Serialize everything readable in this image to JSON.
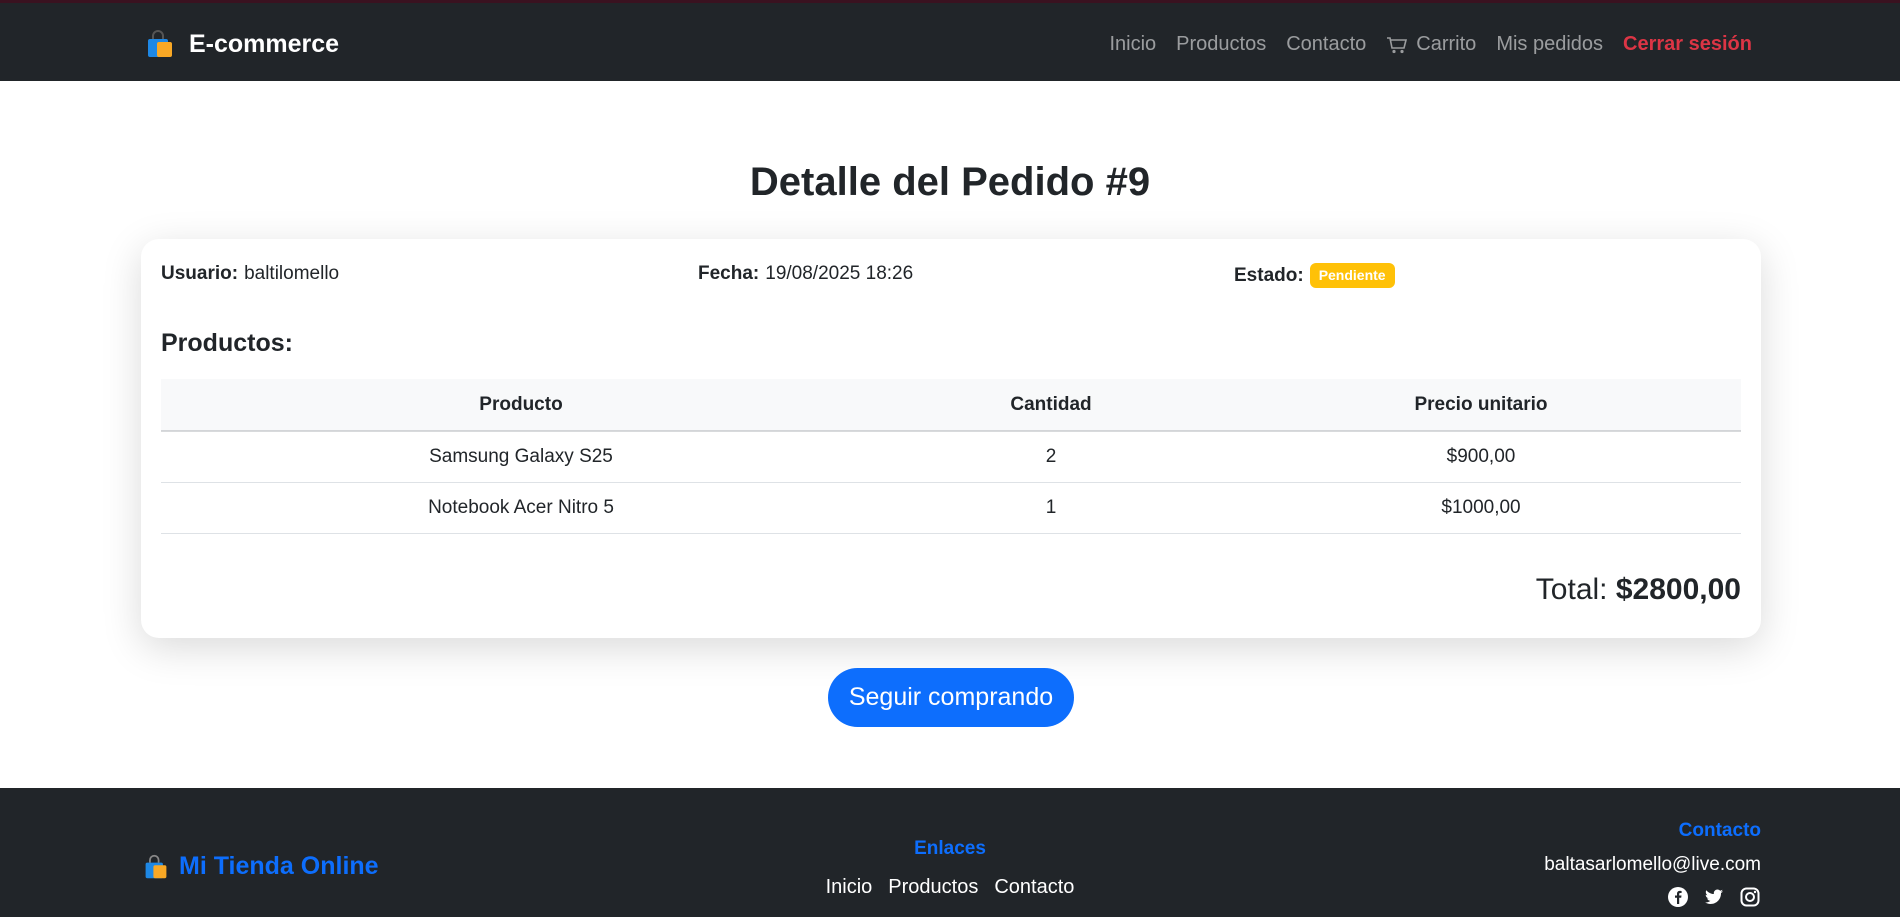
{
  "navbar": {
    "brand": "E-commerce",
    "links": [
      "Inicio",
      "Productos",
      "Contacto",
      "Carrito",
      "Mis pedidos"
    ],
    "logout": "Cerrar sesión"
  },
  "page": {
    "title": "Detalle del Pedido #9"
  },
  "order": {
    "user_label": "Usuario:",
    "user": "baltilomello",
    "date_label": "Fecha:",
    "date": "19/08/2025 18:26",
    "status_label": "Estado:",
    "status": "Pendiente",
    "products_heading": "Productos:",
    "columns": [
      "Producto",
      "Cantidad",
      "Precio unitario"
    ],
    "rows": [
      [
        "Samsung Galaxy S25",
        "2",
        "$900,00"
      ],
      [
        "Notebook Acer Nitro 5",
        "1",
        "$1000,00"
      ]
    ],
    "total_label": "Total:",
    "total": "$2800,00"
  },
  "continue_button": "Seguir comprando",
  "footer": {
    "brand": "Mi Tienda Online",
    "links_heading": "Enlaces",
    "links": [
      "Inicio",
      "Productos",
      "Contacto"
    ],
    "contact_heading": "Contacto",
    "email": "baltasarlomello@live.com",
    "socials": [
      "facebook-icon",
      "twitter-icon",
      "instagram-icon"
    ]
  },
  "colors": {
    "navbar_bg": "#212529",
    "accent": "#0d6efd",
    "logout": "#dc3545",
    "badge": "#ffc107"
  }
}
